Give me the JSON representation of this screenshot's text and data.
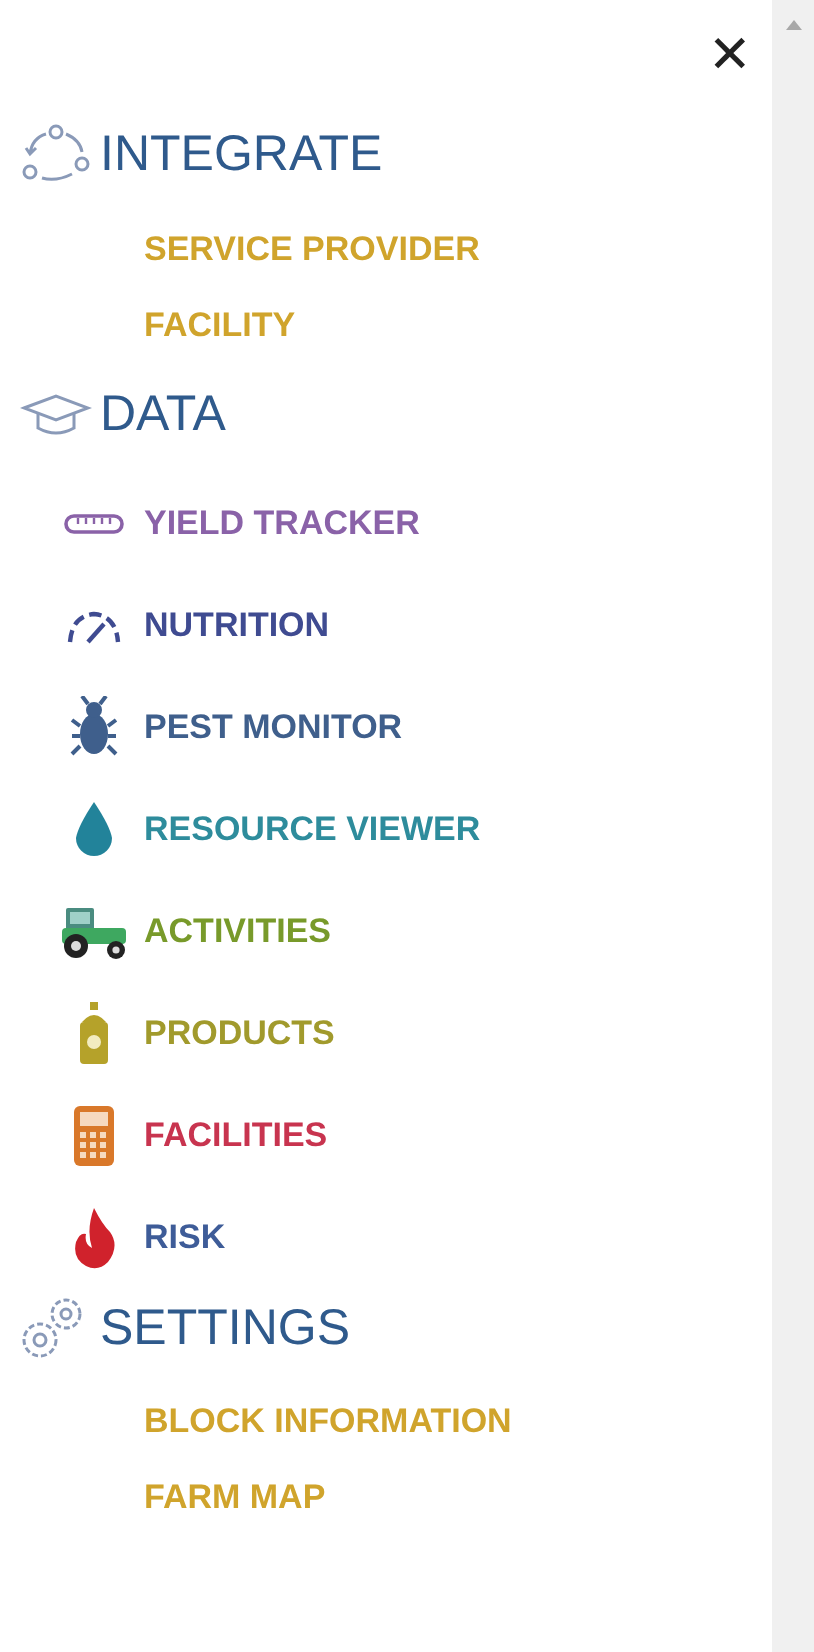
{
  "close_button": {
    "label": "✕"
  },
  "sections": [
    {
      "title": "INTEGRATE",
      "items": [
        {
          "label": "SERVICE PROVIDER",
          "color": "#d0a42c"
        },
        {
          "label": "FACILITY",
          "color": "#d0a42c"
        }
      ]
    },
    {
      "title": "DATA",
      "items": [
        {
          "label": "YIELD TRACKER",
          "color": "#8a62a8"
        },
        {
          "label": "NUTRITION",
          "color": "#3f4b91"
        },
        {
          "label": "PEST MONITOR",
          "color": "#3f5f8c"
        },
        {
          "label": "RESOURCE VIEWER",
          "color": "#2e8c9c"
        },
        {
          "label": "ACTIVITIES",
          "color": "#789a2a"
        },
        {
          "label": "PRODUCTS",
          "color": "#a19a2c"
        },
        {
          "label": "FACILITIES",
          "color": "#c8344f"
        },
        {
          "label": "RISK",
          "color": "#3e5c98"
        }
      ]
    },
    {
      "title": "SETTINGS",
      "items": [
        {
          "label": "BLOCK INFORMATION",
          "color": "#d0a42c"
        },
        {
          "label": "FARM MAP",
          "color": "#d0a42c"
        }
      ]
    }
  ]
}
